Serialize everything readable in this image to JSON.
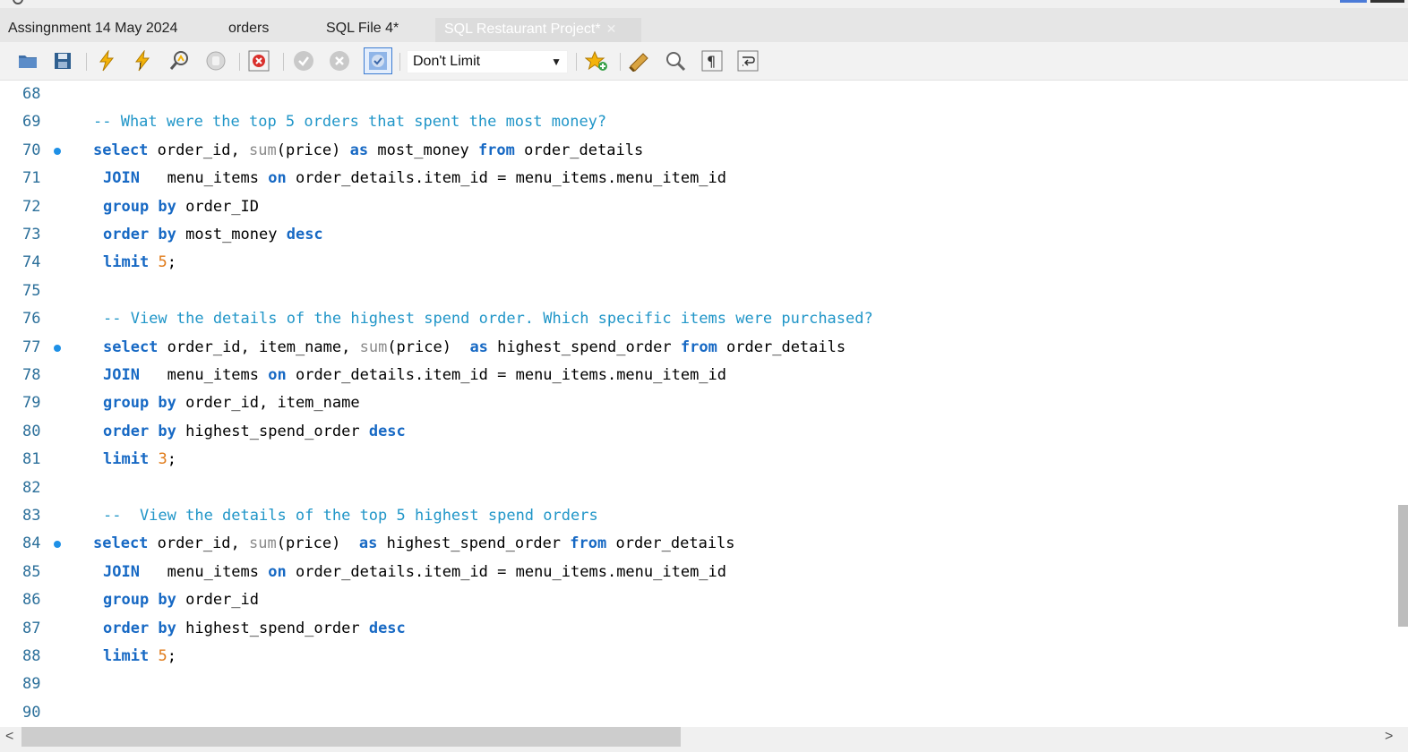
{
  "tabs": [
    {
      "label": "Assingnment 14 May 2024"
    },
    {
      "label": "orders"
    },
    {
      "label": "SQL File 4*"
    },
    {
      "label": "SQL Restaurant Project*",
      "active": true
    }
  ],
  "toolbar": {
    "limit_select": "Don't Limit",
    "icons": [
      "open-file-icon",
      "save-icon",
      "execute-icon",
      "execute-current-icon",
      "explain-icon",
      "stop-icon",
      "toggle-error-icon",
      "commit-icon",
      "rollback-icon",
      "autocommit-icon",
      "add-snippet-icon",
      "beautify-icon",
      "find-icon",
      "invisible-chars-icon",
      "wrap-icon"
    ]
  },
  "editor": {
    "lines": [
      {
        "n": "68",
        "marker": false,
        "indent": 0,
        "tokens": []
      },
      {
        "n": "69",
        "marker": false,
        "indent": 0,
        "tokens": [
          {
            "t": "cm",
            "v": "-- What were the top 5 orders that spent the most money?"
          }
        ]
      },
      {
        "n": "70",
        "marker": true,
        "indent": 0,
        "tokens": [
          {
            "t": "kw",
            "v": "select"
          },
          {
            "t": "id",
            "v": " order_id, "
          },
          {
            "t": "fn",
            "v": "sum"
          },
          {
            "t": "id",
            "v": "(price) "
          },
          {
            "t": "kw",
            "v": "as"
          },
          {
            "t": "id",
            "v": " most_money "
          },
          {
            "t": "kw",
            "v": "from"
          },
          {
            "t": "id",
            "v": " order_details"
          }
        ]
      },
      {
        "n": "71",
        "marker": false,
        "indent": 1,
        "tokens": [
          {
            "t": "kw",
            "v": "JOIN"
          },
          {
            "t": "id",
            "v": "   menu_items "
          },
          {
            "t": "kw",
            "v": "on"
          },
          {
            "t": "id",
            "v": " order_details.item_id = menu_items.menu_item_id"
          }
        ]
      },
      {
        "n": "72",
        "marker": false,
        "indent": 1,
        "tokens": [
          {
            "t": "kw",
            "v": "group by"
          },
          {
            "t": "id",
            "v": " order_ID"
          }
        ]
      },
      {
        "n": "73",
        "marker": false,
        "indent": 1,
        "tokens": [
          {
            "t": "kw",
            "v": "order by"
          },
          {
            "t": "id",
            "v": " most_money "
          },
          {
            "t": "kw",
            "v": "desc"
          }
        ]
      },
      {
        "n": "74",
        "marker": false,
        "indent": 1,
        "tokens": [
          {
            "t": "kw",
            "v": "limit"
          },
          {
            "t": "id",
            "v": " "
          },
          {
            "t": "num",
            "v": "5"
          },
          {
            "t": "id",
            "v": ";"
          }
        ]
      },
      {
        "n": "75",
        "marker": false,
        "indent": 0,
        "tokens": []
      },
      {
        "n": "76",
        "marker": false,
        "indent": 1,
        "tokens": [
          {
            "t": "cm",
            "v": "-- View the details of the highest spend order. Which specific items were purchased?"
          }
        ]
      },
      {
        "n": "77",
        "marker": true,
        "indent": 1,
        "tokens": [
          {
            "t": "kw",
            "v": "select"
          },
          {
            "t": "id",
            "v": " order_id, item_name, "
          },
          {
            "t": "fn",
            "v": "sum"
          },
          {
            "t": "id",
            "v": "(price)  "
          },
          {
            "t": "kw",
            "v": "as"
          },
          {
            "t": "id",
            "v": " highest_spend_order "
          },
          {
            "t": "kw",
            "v": "from"
          },
          {
            "t": "id",
            "v": " order_details"
          }
        ]
      },
      {
        "n": "78",
        "marker": false,
        "indent": 1,
        "tokens": [
          {
            "t": "kw",
            "v": "JOIN"
          },
          {
            "t": "id",
            "v": "   menu_items "
          },
          {
            "t": "kw",
            "v": "on"
          },
          {
            "t": "id",
            "v": " order_details.item_id = menu_items.menu_item_id"
          }
        ]
      },
      {
        "n": "79",
        "marker": false,
        "indent": 1,
        "tokens": [
          {
            "t": "kw",
            "v": "group by"
          },
          {
            "t": "id",
            "v": " order_id, item_name"
          }
        ]
      },
      {
        "n": "80",
        "marker": false,
        "indent": 1,
        "tokens": [
          {
            "t": "kw",
            "v": "order by"
          },
          {
            "t": "id",
            "v": " highest_spend_order "
          },
          {
            "t": "kw",
            "v": "desc"
          }
        ]
      },
      {
        "n": "81",
        "marker": false,
        "indent": 1,
        "tokens": [
          {
            "t": "kw",
            "v": "limit"
          },
          {
            "t": "id",
            "v": " "
          },
          {
            "t": "num",
            "v": "3"
          },
          {
            "t": "id",
            "v": ";"
          }
        ]
      },
      {
        "n": "82",
        "marker": false,
        "indent": 0,
        "tokens": []
      },
      {
        "n": "83",
        "marker": false,
        "indent": 1,
        "tokens": [
          {
            "t": "cm",
            "v": "--  View the details of the top 5 highest spend orders"
          }
        ]
      },
      {
        "n": "84",
        "marker": true,
        "indent": 0,
        "tokens": [
          {
            "t": "kw",
            "v": "select"
          },
          {
            "t": "id",
            "v": " order_id, "
          },
          {
            "t": "fn",
            "v": "sum"
          },
          {
            "t": "id",
            "v": "(price)  "
          },
          {
            "t": "kw",
            "v": "as"
          },
          {
            "t": "id",
            "v": " highest_spend_order "
          },
          {
            "t": "kw",
            "v": "from"
          },
          {
            "t": "id",
            "v": " order_details"
          }
        ]
      },
      {
        "n": "85",
        "marker": false,
        "indent": 1,
        "tokens": [
          {
            "t": "kw",
            "v": "JOIN"
          },
          {
            "t": "id",
            "v": "   menu_items "
          },
          {
            "t": "kw",
            "v": "on"
          },
          {
            "t": "id",
            "v": " order_details.item_id = menu_items.menu_item_id"
          }
        ]
      },
      {
        "n": "86",
        "marker": false,
        "indent": 1,
        "tokens": [
          {
            "t": "kw",
            "v": "group by"
          },
          {
            "t": "id",
            "v": " order_id"
          }
        ]
      },
      {
        "n": "87",
        "marker": false,
        "indent": 1,
        "tokens": [
          {
            "t": "kw",
            "v": "order by"
          },
          {
            "t": "id",
            "v": " highest_spend_order "
          },
          {
            "t": "kw",
            "v": "desc"
          }
        ]
      },
      {
        "n": "88",
        "marker": false,
        "indent": 1,
        "tokens": [
          {
            "t": "kw",
            "v": "limit"
          },
          {
            "t": "id",
            "v": " "
          },
          {
            "t": "num",
            "v": "5"
          },
          {
            "t": "id",
            "v": ";"
          }
        ]
      },
      {
        "n": "89",
        "marker": false,
        "indent": 0,
        "tokens": []
      },
      {
        "n": "90",
        "marker": false,
        "indent": 0,
        "tokens": []
      }
    ]
  },
  "scroll": {
    "left_arrow": "<",
    "right_arrow": ">"
  },
  "colors": {
    "keyword": "#1769c4",
    "comment": "#2196c8",
    "function": "#8a8a8a",
    "number": "#e07b1a",
    "line_number": "#2b6f9a",
    "marker": "#1e90e6"
  }
}
